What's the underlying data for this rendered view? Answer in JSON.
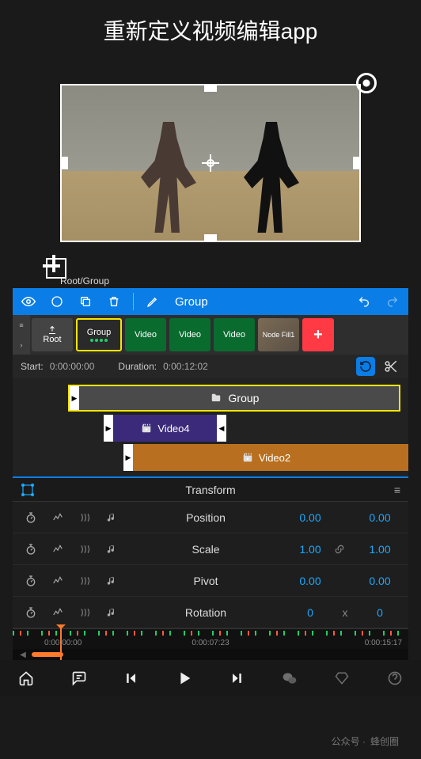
{
  "header": {
    "title": "重新定义视频编辑app"
  },
  "breadcrumb": "Root/Group",
  "toolbar": {
    "eye": "",
    "circle": "",
    "copy": "",
    "trash": "",
    "pencil": "",
    "label": "Group",
    "undo": "",
    "redo": ""
  },
  "nodes": {
    "root": "Root",
    "group": "Group",
    "video1": "Video",
    "video2": "Video",
    "video3": "Video",
    "fill": "Node Fill1",
    "add": "+"
  },
  "time": {
    "startLabel": "Start:",
    "startVal": "0:00:00:00",
    "durLabel": "Duration:",
    "durVal": "0:00:12:02"
  },
  "groupTrack": "Group",
  "video4": "Video4",
  "video2clip": "Video2",
  "transform": {
    "title": "Transform",
    "rows": [
      {
        "name": "Position",
        "v1": "0.00",
        "link": "",
        "v2": "0.00"
      },
      {
        "name": "Scale",
        "v1": "1.00",
        "link": "link",
        "v2": "1.00"
      },
      {
        "name": "Pivot",
        "v1": "0.00",
        "link": "",
        "v2": "0.00"
      },
      {
        "name": "Rotation",
        "v1": "0",
        "link": "x",
        "v2": "0"
      }
    ]
  },
  "ruler": {
    "t1": "0:00:00:00",
    "t2": "0:00:07:23",
    "t3": "0:00:15:17"
  },
  "watermark": {
    "prefix": "公众号 · ",
    "name": "蜂创圈"
  }
}
